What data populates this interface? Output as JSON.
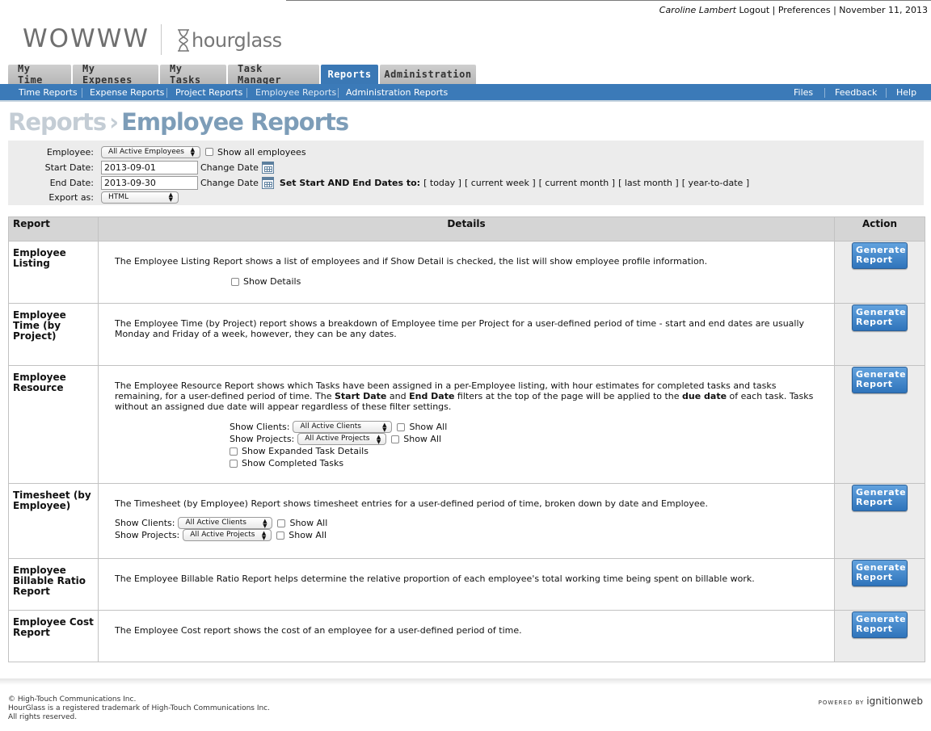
{
  "userbar": {
    "user_name": "Caroline Lambert",
    "logout": "Logout",
    "preferences": "Preferences",
    "date": "November 11, 2013",
    "sep": "|"
  },
  "logo": {
    "brand": "WOWWW",
    "product": "hourglass"
  },
  "tabs": [
    {
      "label": "My Time"
    },
    {
      "label": "My Expenses"
    },
    {
      "label": "My Tasks"
    },
    {
      "label": "Task Manager"
    },
    {
      "label": "Reports",
      "active": true
    },
    {
      "label": "Administration"
    }
  ],
  "subnav": {
    "left": [
      "Time Reports",
      "Expense Reports",
      "Project Reports",
      "Employee Reports",
      "Administration Reports"
    ],
    "right": [
      "Files",
      "Feedback",
      "Help"
    ]
  },
  "page_title": {
    "crumb": "Reports",
    "separator": "›",
    "current": "Employee Reports"
  },
  "filters": {
    "employee_label": "Employee:",
    "employee_value": "All Active Employees",
    "show_all_employees": "Show all employees",
    "start_label": "Start Date:",
    "start_value": "2013-09-01",
    "end_label": "End Date:",
    "end_value": "2013-09-30",
    "change_date": "Change Date",
    "set_dates_label": "Set Start AND End Dates to:",
    "quick_dates": [
      "[ today ]",
      "[ current week ]",
      "[ current month ]",
      "[ last month ]",
      "[ year-to-date ]"
    ],
    "export_label": "Export as:",
    "export_value": "HTML"
  },
  "table": {
    "headers": {
      "report": "Report",
      "details": "Details",
      "action": "Action"
    },
    "button_line1": "Generate",
    "button_line2": "Report",
    "rows": [
      {
        "name": "Employee Listing",
        "desc": "The Employee Listing Report shows a list of employees and if Show Detail is checked, the list will show employee profile information.",
        "opt_show_details": "Show Details"
      },
      {
        "name": "Employee Time (by Project)",
        "desc": "The Employee Time (by Project) report shows a breakdown of Employee time per Project for a user-defined period of time - start and end dates are usually Monday and Friday of a week, however, they can be any dates."
      },
      {
        "name": "Employee Resource",
        "desc_a": "The Employee Resource Report shows which Tasks have been assigned in a per-Employee listing, with hour estimates for completed tasks and tasks remaining, for a user-defined period of time. The ",
        "desc_b1": "Start Date",
        "desc_c": " and ",
        "desc_b2": "End Date",
        "desc_d": " filters at the top of the page will be applied to the ",
        "desc_b3": "due date",
        "desc_e": " of each task. Tasks without an assigned due date will appear regardless of these filter settings.",
        "clients_label": "Show Clients:",
        "clients_value": "All Active Clients",
        "projects_label": "Show Projects:",
        "projects_value": "All Active Projects",
        "show_all": "Show All",
        "opt_expanded": "Show Expanded Task Details",
        "opt_completed": "Show Completed Tasks"
      },
      {
        "name": "Timesheet (by Employee)",
        "desc": "The Timesheet (by Employee) Report shows timesheet entries for a user-defined period of time, broken down by date and Employee.",
        "clients_label": "Show Clients:",
        "clients_value": "All Active Clients",
        "projects_label": "Show Projects:",
        "projects_value": "All Active Projects",
        "show_all": "Show All"
      },
      {
        "name": "Employee Billable Ratio Report",
        "desc": "The Employee Billable Ratio Report helps determine the relative proportion of each employee's total working time being spent on billable work."
      },
      {
        "name": "Employee Cost Report",
        "desc": "The Employee Cost report shows the cost of an employee for a user-defined period of time."
      }
    ]
  },
  "footer": {
    "line1": "© High-Touch Communications Inc.",
    "line2": "HourGlass is a registered trademark of High-Touch Communications Inc.",
    "line3": "All rights reserved.",
    "powered_by": "POWERED BY",
    "vendor": "ignitionweb"
  },
  "colors": {
    "tab_active": "#3a78b5",
    "subnav_bg": "#3b7ab8",
    "title_current": "#7d9db8",
    "button": "#2f74bb"
  }
}
